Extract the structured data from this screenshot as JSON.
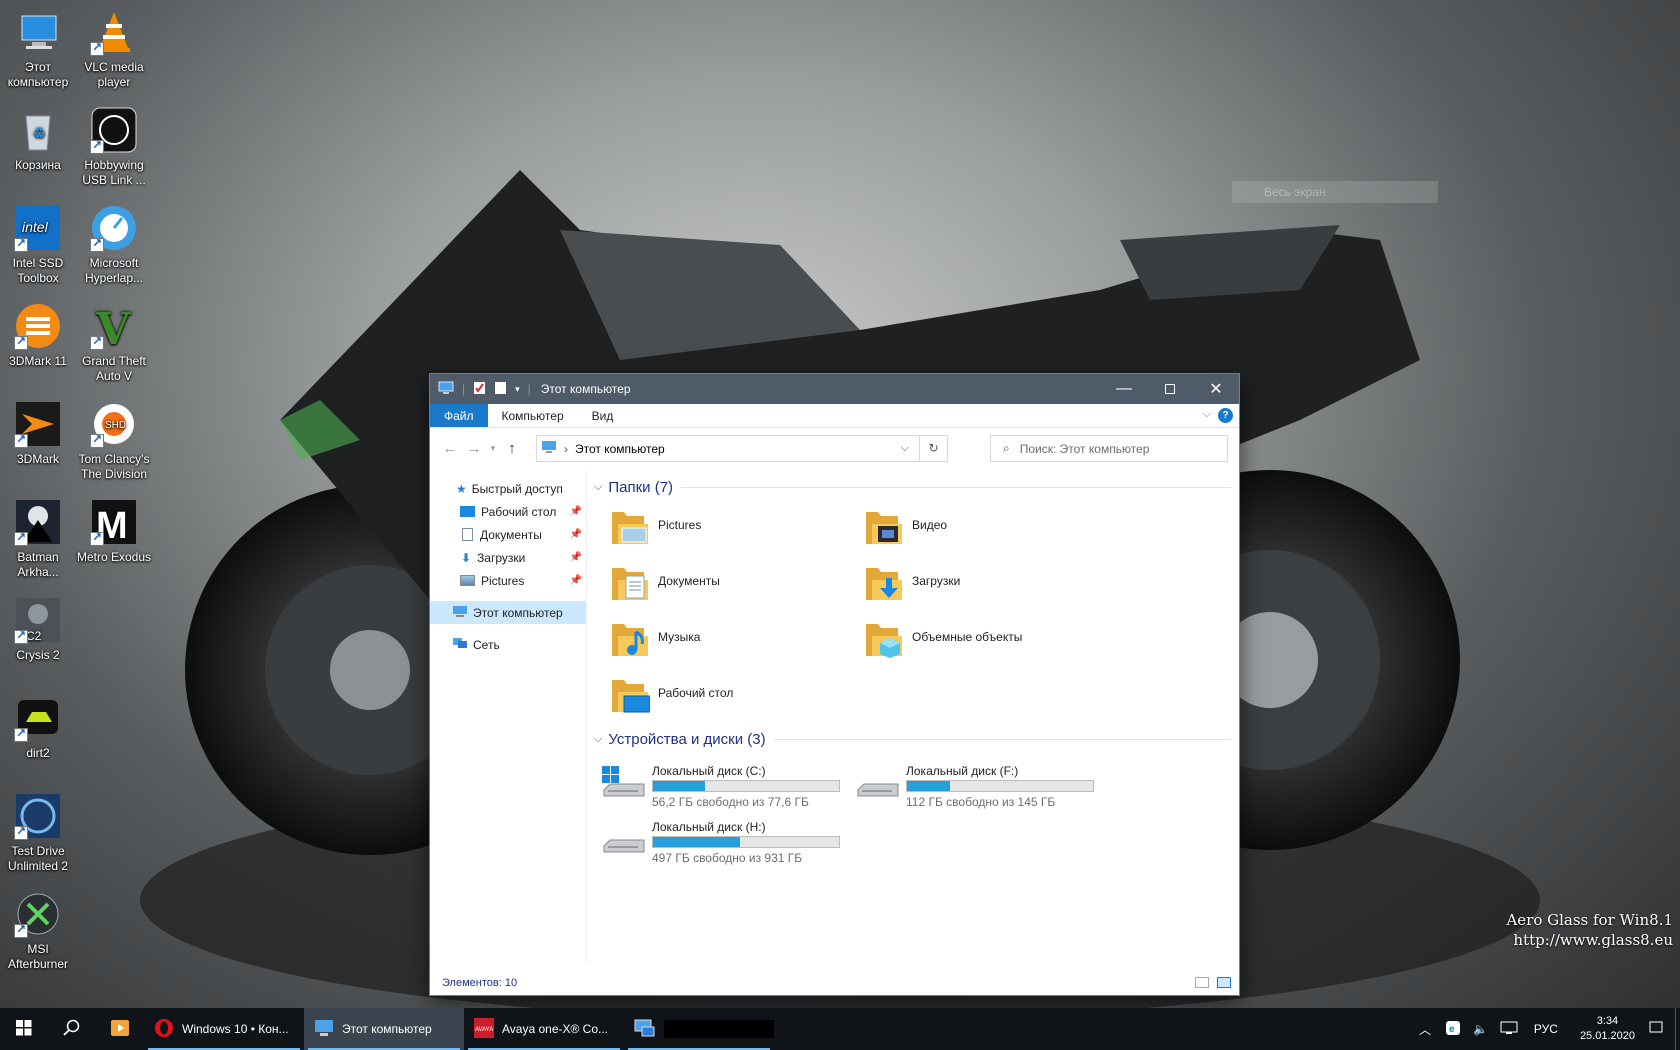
{
  "desktop": {
    "icons": [
      {
        "label": "Этот компьютер"
      },
      {
        "label": "VLC media player"
      },
      {
        "label": "Корзина"
      },
      {
        "label": "Hobbywing USB Link ..."
      },
      {
        "label": "Intel SSD Toolbox"
      },
      {
        "label": "Microsoft Hyperlap..."
      },
      {
        "label": "3DMark 11"
      },
      {
        "label": "Grand Theft Auto V"
      },
      {
        "label": "3DMark"
      },
      {
        "label": "Tom Clancy's The Division"
      },
      {
        "label": "Batman Arkha..."
      },
      {
        "label": "Metro Exodus"
      },
      {
        "label": "Crysis 2"
      },
      {
        "label": "dirt2"
      },
      {
        "label": "Test Drive Unlimited 2"
      },
      {
        "label": "MSI Afterburner"
      }
    ],
    "ghost_box": "Весь экран",
    "watermark": {
      "line1": "Aero Glass for Win8.1",
      "line2": "http://www.glass8.eu"
    }
  },
  "window": {
    "title": "Этот компьютер",
    "ribbon_tabs": [
      "Файл",
      "Компьютер",
      "Вид"
    ],
    "help": "?",
    "address": "Этот компьютер",
    "search_placeholder": "Поиск: Этот компьютер",
    "nav": {
      "quick_access": "Быстрый доступ",
      "pinned": [
        "Рабочий стол",
        "Документы",
        "Загрузки",
        "Pictures"
      ],
      "this_pc": "Этот компьютер",
      "network": "Сеть"
    },
    "folders_header": "Папки (7)",
    "folders": [
      "Pictures",
      "Видео",
      "Документы",
      "Загрузки",
      "Музыка",
      "Объемные объекты",
      "Рабочий стол"
    ],
    "drives_header": "Устройства и диски (3)",
    "drives": [
      {
        "name": "Локальный диск (C:)",
        "free": "56,2 ГБ свободно из 77,6 ГБ",
        "used_fraction": 0.28
      },
      {
        "name": "Локальный диск (F:)",
        "free": "112 ГБ свободно из 145 ГБ",
        "used_fraction": 0.23
      },
      {
        "name": "Локальный диск (H:)",
        "free": "497 ГБ свободно из 931 ГБ",
        "used_fraction": 0.47
      }
    ],
    "status": "Элементов: 10"
  },
  "taskbar": {
    "apps": [
      {
        "label": "Windows 10 • Кон..."
      },
      {
        "label": "Этот компьютер"
      },
      {
        "label": "Avaya one-X® Co..."
      }
    ],
    "language": "РУС",
    "time": "3:34",
    "date": "25.01.2020"
  },
  "colors": {
    "accent": "#1979ca",
    "folder": "#f6c95a",
    "drive_bar": "#26a0da",
    "group_header": "#1e3287"
  }
}
